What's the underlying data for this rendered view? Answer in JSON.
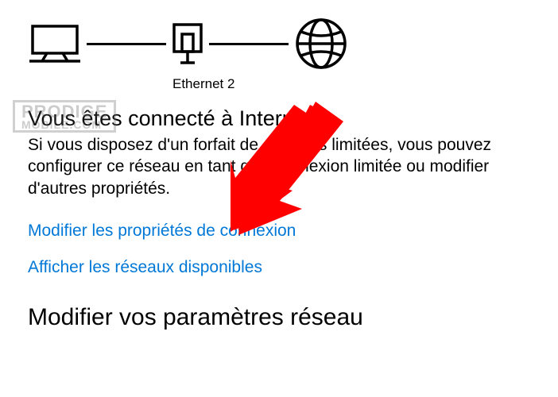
{
  "diagram": {
    "adapter_label": "Ethernet 2",
    "icons": {
      "computer": "computer-icon",
      "adapter": "network-adapter-icon",
      "globe": "globe-icon"
    }
  },
  "status": {
    "heading": "Vous êtes connecté à Internet",
    "description": "Si vous disposez d'un forfait de données limitées, vous pouvez configurer ce réseau en tant que connexion limitée ou modifier d'autres propriétés."
  },
  "links": {
    "change_properties": "Modifier les propriétés de connexion",
    "show_networks": "Afficher les réseaux disponibles"
  },
  "section": {
    "heading": "Modifier vos paramètres réseau"
  },
  "watermark": {
    "line1": "PRODIGE",
    "line2": "MOBILE.COM"
  },
  "annotation": {
    "arrow_color": "#ff0000"
  }
}
